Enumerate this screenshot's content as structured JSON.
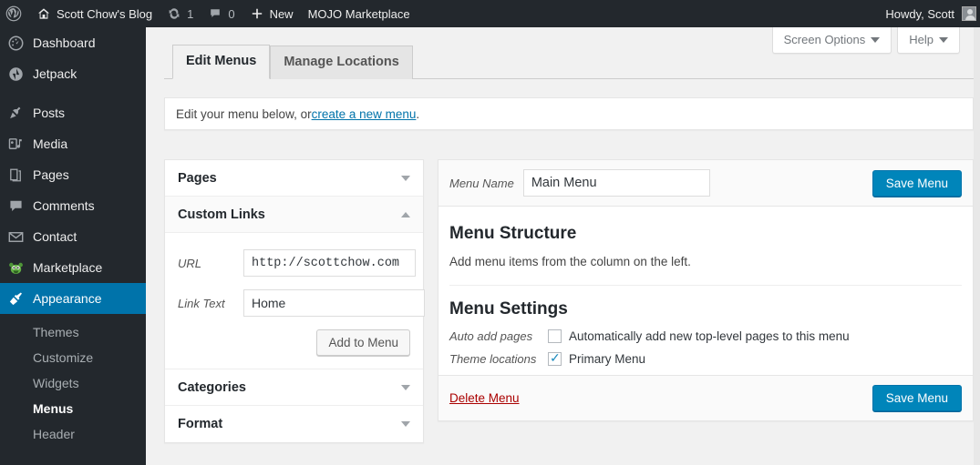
{
  "adminbar": {
    "wp_logo": "wordpress-logo-icon",
    "site_name": "Scott Chow's Blog",
    "updates_icon": "updates-icon",
    "updates_count": "1",
    "comments_icon": "comment-bubble-icon",
    "comments_count": "0",
    "new_icon": "plus-icon",
    "new_label": "New",
    "marketplace_label": "MOJO Marketplace",
    "howdy": "Howdy, Scott",
    "avatar": "user-avatar"
  },
  "sidebar": {
    "items": [
      {
        "label": "Dashboard",
        "icon": "dashboard-gauge-icon",
        "current": false
      },
      {
        "label": "Jetpack",
        "icon": "jetpack-icon",
        "current": false
      },
      {
        "label": "Posts",
        "icon": "pin-icon",
        "current": false
      },
      {
        "label": "Media",
        "icon": "media-music-icon",
        "current": false
      },
      {
        "label": "Pages",
        "icon": "pages-icon",
        "current": false
      },
      {
        "label": "Comments",
        "icon": "comment-bubble-icon",
        "current": false
      },
      {
        "label": "Contact",
        "icon": "envelope-icon",
        "current": false
      },
      {
        "label": "Marketplace",
        "icon": "mascot-icon",
        "current": false
      },
      {
        "label": "Appearance",
        "icon": "paintbrush-icon",
        "current": true
      }
    ],
    "submenu": [
      {
        "label": "Themes",
        "current": false
      },
      {
        "label": "Customize",
        "current": false
      },
      {
        "label": "Widgets",
        "current": false
      },
      {
        "label": "Menus",
        "current": true
      },
      {
        "label": "Header",
        "current": false
      }
    ]
  },
  "screen_meta": {
    "screen_options": "Screen Options",
    "help": "Help"
  },
  "tabs": [
    {
      "label": "Edit Menus",
      "active": true
    },
    {
      "label": "Manage Locations",
      "active": false
    }
  ],
  "notice": {
    "text_before": "Edit your menu below, or ",
    "link": "create a new menu",
    "text_after": "."
  },
  "accordion": {
    "pages": {
      "title": "Pages",
      "arrow": "chevron-down-icon",
      "open": false
    },
    "custom_links": {
      "title": "Custom Links",
      "arrow": "chevron-up-icon",
      "open": true,
      "url_label": "URL",
      "url_value": "http://scottchow.com",
      "url_placeholder": "http://",
      "link_text_label": "Link Text",
      "link_text_value": "Home",
      "link_text_placeholder": "",
      "add_button": "Add to Menu"
    },
    "categories": {
      "title": "Categories",
      "arrow": "chevron-down-icon",
      "open": false
    },
    "format": {
      "title": "Format",
      "arrow": "chevron-down-icon",
      "open": false
    }
  },
  "menu_panel": {
    "menu_name_label": "Menu Name",
    "menu_name_value": "Main Menu",
    "menu_name_placeholder": "Menu Name",
    "save_top": "Save Menu",
    "structure_heading": "Menu Structure",
    "structure_help": "Add menu items from the column on the left.",
    "settings_heading": "Menu Settings",
    "auto_add_label": "Auto add pages",
    "auto_add_text": "Automatically add new top-level pages to this menu",
    "auto_add_checked": false,
    "theme_locations_label": "Theme locations",
    "theme_locations_text": "Primary Menu",
    "theme_locations_checked": true,
    "delete_menu": "Delete Menu",
    "save_bottom": "Save Menu"
  },
  "colors": {
    "accent_blue": "#0085ba",
    "sidebar_bg": "#23282d",
    "current_menu": "#0073aa",
    "link_blue": "#0073aa",
    "delete_red": "#a00",
    "page_bg": "#f1f1f1"
  }
}
